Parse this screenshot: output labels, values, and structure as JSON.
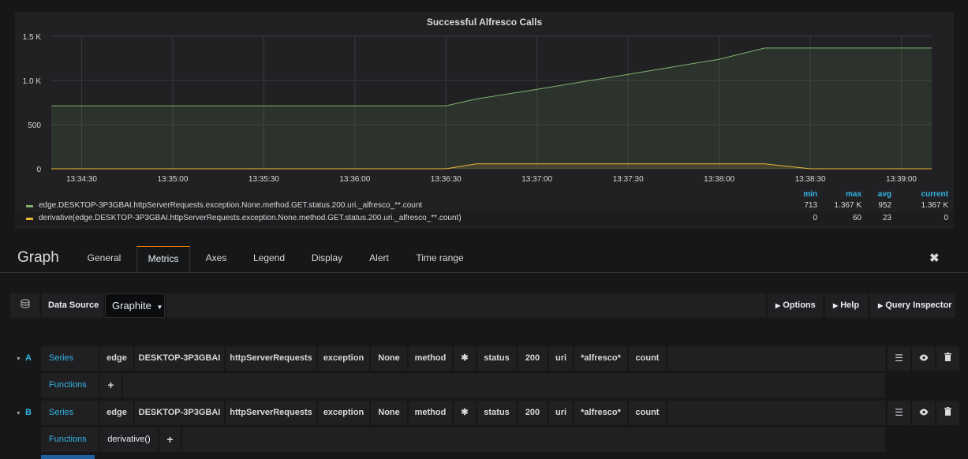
{
  "panel": {
    "title": "Successful Alfresco Calls"
  },
  "chart_data": {
    "type": "area",
    "title": "Successful Alfresco Calls",
    "x": [
      "13:34:20",
      "13:34:30",
      "13:35:00",
      "13:35:30",
      "13:36:00",
      "13:36:30",
      "13:36:40",
      "13:37:00",
      "13:37:30",
      "13:38:00",
      "13:38:15",
      "13:38:30",
      "13:39:00",
      "13:39:10"
    ],
    "x_ticks": [
      "13:34:30",
      "13:35:00",
      "13:35:30",
      "13:36:00",
      "13:36:30",
      "13:37:00",
      "13:37:30",
      "13:38:00",
      "13:38:30",
      "13:39:00"
    ],
    "y_ticks": [
      "0",
      "500",
      "1.0 K",
      "1.5 K"
    ],
    "ylim": [
      0,
      1500
    ],
    "grid": true,
    "legend": "bottom",
    "series": [
      {
        "name": "edge.DESKTOP-3P3GBAI.httpServerRequests.exception.None.method.GET.status.200.uri._alfresco_**.count",
        "color": "#7eb26d",
        "values": [
          713,
          713,
          713,
          713,
          713,
          713,
          790,
          900,
          1070,
          1240,
          1367,
          1367,
          1367,
          1367
        ]
      },
      {
        "name": "derivative(edge.DESKTOP-3P3GBAI.httpServerRequests.exception.None.method.GET.status.200.uri._alfresco_**.count)",
        "color": "#eab839",
        "values": [
          0,
          0,
          0,
          0,
          0,
          0,
          55,
          55,
          55,
          55,
          55,
          0,
          0,
          0
        ]
      }
    ]
  },
  "legend": {
    "headers": [
      "min",
      "max",
      "avg",
      "current"
    ],
    "rows": [
      {
        "name": "edge.DESKTOP-3P3GBAI.httpServerRequests.exception.None.method.GET.status.200.uri._alfresco_**.count",
        "color": "#7eb26d",
        "min": "713",
        "max": "1.367 K",
        "avg": "952",
        "current": "1.367 K"
      },
      {
        "name": "derivative(edge.DESKTOP-3P3GBAI.httpServerRequests.exception.None.method.GET.status.200.uri._alfresco_**.count)",
        "color": "#eab839",
        "min": "0",
        "max": "60",
        "avg": "23",
        "current": "0"
      }
    ]
  },
  "editor": {
    "title": "Graph",
    "tabs": [
      "General",
      "Metrics",
      "Axes",
      "Legend",
      "Display",
      "Alert",
      "Time range"
    ],
    "active_tab": "Metrics",
    "close_icon": "✖"
  },
  "toolbar": {
    "datasource_label": "Data Source",
    "datasource_value": "Graphite",
    "options": "Options",
    "help": "Help",
    "query_inspector": "Query Inspector"
  },
  "queries": [
    {
      "letter": "A",
      "series_label": "Series",
      "segments": [
        "edge",
        "DESKTOP-3P3GBAI",
        "httpServerRequests",
        "exception",
        "None",
        "method",
        "✱",
        "status",
        "200",
        "uri",
        "*alfresco*",
        "count"
      ],
      "functions_label": "Functions",
      "functions": [],
      "add": "+"
    },
    {
      "letter": "B",
      "series_label": "Series",
      "segments": [
        "edge",
        "DESKTOP-3P3GBAI",
        "httpServerRequests",
        "exception",
        "None",
        "method",
        "✱",
        "status",
        "200",
        "uri",
        "*alfresco*",
        "count"
      ],
      "functions_label": "Functions",
      "functions": [
        "derivative()"
      ],
      "add": "+"
    }
  ]
}
